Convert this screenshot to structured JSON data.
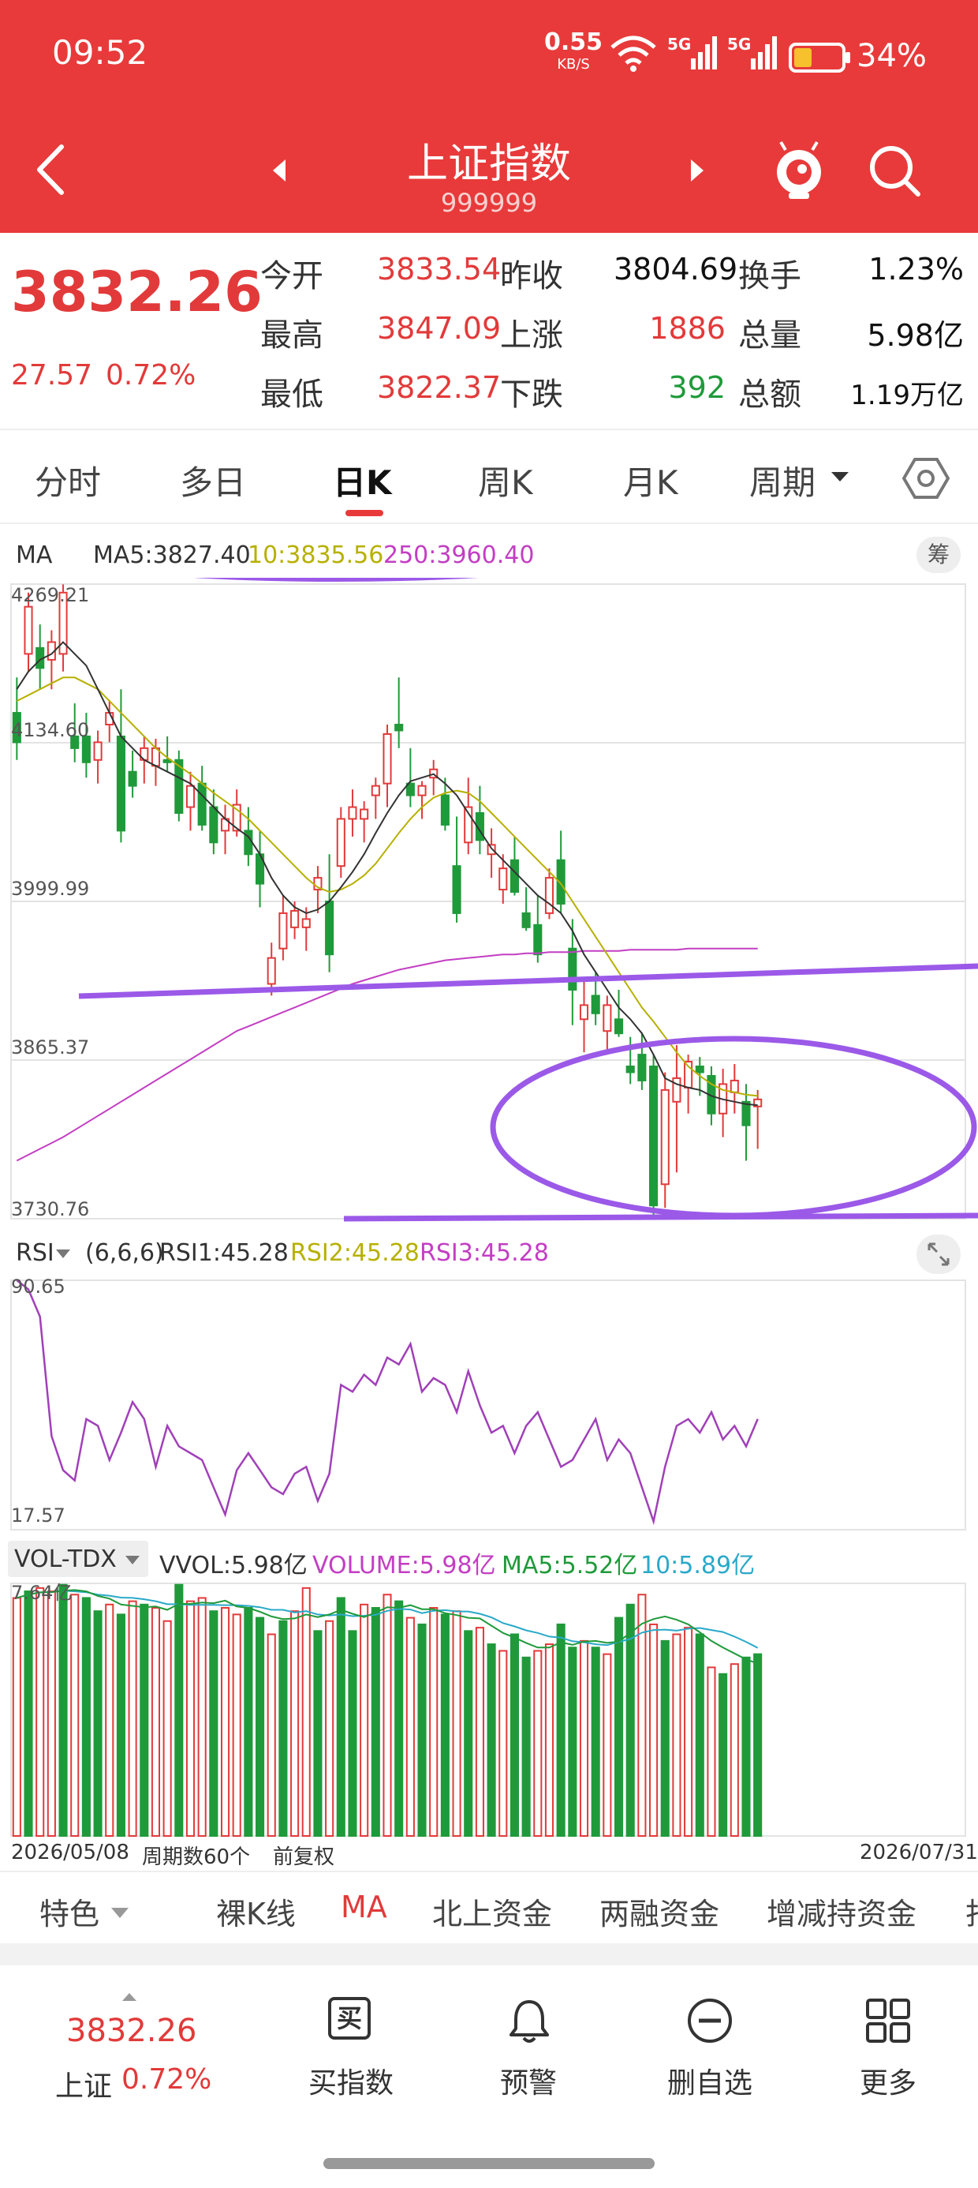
{
  "status_bar": {
    "time": "09:52",
    "net_speed": "0.55",
    "net_unit": "KB/S",
    "sig1": "5G",
    "sig2": "5G",
    "battery": "34%"
  },
  "header": {
    "title": "上证指数",
    "code": "999999"
  },
  "quote": {
    "price": "3832.26",
    "change": "27.57",
    "change_pct": "0.72%",
    "open_label": "今开",
    "open": "3833.54",
    "high_label": "最高",
    "high": "3847.09",
    "low_label": "最低",
    "low": "3822.37",
    "prev_label": "昨收",
    "prev": "3804.69",
    "up_label": "上涨",
    "up": "1886",
    "down_label": "下跌",
    "down": "392",
    "turnover_label": "换手",
    "turnover": "1.23%",
    "volume_label": "总量",
    "volume": "5.98亿",
    "amount_label": "总额",
    "amount": "1.19万亿"
  },
  "tabs": [
    "分时",
    "多日",
    "日K",
    "周K",
    "月K",
    "周期"
  ],
  "active_tab": 2,
  "ma_bar": {
    "name": "MA",
    "ma5": "MA5:3827.40",
    "ma10": "10:3835.56",
    "ma250": "250:3960.40",
    "chip_btn": "筹"
  },
  "price_axis": [
    "4269.21",
    "4134.60",
    "3999.99",
    "3865.37",
    "3730.76"
  ],
  "rsi_bar": {
    "name": "RSI",
    "params": "(6,6,6)",
    "rsi1": "RSI1:45.28",
    "rsi2": "RSI2:45.28",
    "rsi3": "RSI3:45.28"
  },
  "rsi_axis": [
    "90.65",
    "17.57"
  ],
  "vol_bar": {
    "name": "VOL-TDX",
    "vvol": "VVOL:5.98亿",
    "volume": "VOLUME:5.98亿",
    "ma5": "MA5:5.52亿",
    "ma10": "10:5.89亿"
  },
  "vol_axis": [
    "7.64亿"
  ],
  "footer_axis": {
    "start": "2026/05/08",
    "periods": "周期数60个",
    "adjust": "前复权",
    "end": "2026/07/31"
  },
  "indicator_tabs": [
    "特色",
    "裸K线",
    "MA",
    "北上资金",
    "两融资金",
    "增减持资金",
    "打"
  ],
  "bottom_nav": {
    "price": "3832.26",
    "name": "上证",
    "pct": "0.72%",
    "buy_icon_text": "买",
    "buy": "买指数",
    "alert": "预警",
    "remove": "删自选",
    "more": "更多"
  },
  "colors": {
    "up": "#e23a3a",
    "down": "#1f9a3a",
    "header": "#e83a3a",
    "annotation": "#9b59e8",
    "ma10": "#b7b000",
    "ma250": "#c33ec3"
  },
  "chart_data": {
    "type": "candlestick",
    "x_range": [
      "2026/05/08",
      "2026/07/31"
    ],
    "ylim": [
      3730.76,
      4269.21
    ],
    "candles_ohlc": [
      [
        4160,
        4190,
        4120,
        4135
      ],
      [
        4210,
        4262,
        4195,
        4250
      ],
      [
        4215,
        4235,
        4180,
        4198
      ],
      [
        4205,
        4230,
        4180,
        4220
      ],
      [
        4210,
        4269,
        4195,
        4262
      ],
      [
        4140,
        4168,
        4118,
        4130
      ],
      [
        4140,
        4160,
        4105,
        4118
      ],
      [
        4120,
        4145,
        4100,
        4135
      ],
      [
        4150,
        4170,
        4135,
        4160
      ],
      [
        4140,
        4180,
        4050,
        4060
      ],
      [
        4110,
        4128,
        4088,
        4098
      ],
      [
        4120,
        4140,
        4100,
        4130
      ],
      [
        4115,
        4138,
        4098,
        4130
      ],
      [
        4120,
        4140,
        4110,
        4118
      ],
      [
        4120,
        4128,
        4068,
        4075
      ],
      [
        4080,
        4110,
        4060,
        4098
      ],
      [
        4100,
        4115,
        4060,
        4065
      ],
      [
        4080,
        4095,
        4040,
        4050
      ],
      [
        4060,
        4082,
        4040,
        4070
      ],
      [
        4060,
        4095,
        4055,
        4082
      ],
      [
        4060,
        4080,
        4030,
        4040
      ],
      [
        4040,
        4060,
        3995,
        4015
      ],
      [
        3930,
        3965,
        3920,
        3952
      ],
      [
        3960,
        4005,
        3950,
        3990
      ],
      [
        3978,
        4000,
        3968,
        3992
      ],
      [
        3978,
        3995,
        3958,
        3985
      ],
      [
        4010,
        4030,
        3990,
        4020
      ],
      [
        4000,
        4040,
        3940,
        3955
      ],
      [
        4030,
        4080,
        4020,
        4070
      ],
      [
        4070,
        4095,
        4055,
        4080
      ],
      [
        4070,
        4085,
        4050,
        4078
      ],
      [
        4090,
        4105,
        4070,
        4098
      ],
      [
        4100,
        4150,
        4080,
        4142
      ],
      [
        4150,
        4190,
        4130,
        4145
      ],
      [
        4100,
        4130,
        4080,
        4090
      ],
      [
        4090,
        4102,
        4070,
        4098
      ],
      [
        4105,
        4120,
        4090,
        4112
      ],
      [
        4090,
        4105,
        4060,
        4065
      ],
      [
        4030,
        4072,
        3982,
        3990
      ],
      [
        4050,
        4105,
        4040,
        4080
      ],
      [
        4075,
        4098,
        4040,
        4052
      ],
      [
        4040,
        4062,
        4020,
        4048
      ],
      [
        4010,
        4040,
        3998,
        4028
      ],
      [
        4035,
        4055,
        4005,
        4008
      ],
      [
        3990,
        4012,
        3975,
        3978
      ],
      [
        3980,
        4005,
        3948,
        3955
      ],
      [
        3990,
        4028,
        3985,
        4020
      ],
      [
        4035,
        4060,
        3990,
        3998
      ],
      [
        3960,
        3985,
        3895,
        3925
      ],
      [
        3900,
        3935,
        3872,
        3912
      ],
      [
        3920,
        3940,
        3895,
        3905
      ],
      [
        3890,
        3920,
        3870,
        3912
      ],
      [
        3900,
        3925,
        3885,
        3888
      ],
      [
        3860,
        3885,
        3845,
        3855
      ],
      [
        3870,
        3888,
        3840,
        3848
      ],
      [
        3860,
        3870,
        3730,
        3742
      ],
      [
        3760,
        3855,
        3740,
        3840
      ],
      [
        3830,
        3878,
        3770,
        3850
      ],
      [
        3842,
        3870,
        3820,
        3864
      ],
      [
        3860,
        3868,
        3835,
        3855
      ],
      [
        3852,
        3860,
        3810,
        3820
      ],
      [
        3820,
        3858,
        3800,
        3845
      ],
      [
        3838,
        3862,
        3820,
        3848
      ],
      [
        3830,
        3845,
        3780,
        3810
      ],
      [
        3826,
        3840,
        3790,
        3832
      ]
    ],
    "ma5": [
      4180,
      4195,
      4205,
      4210,
      4220,
      4210,
      4200,
      4180,
      4160,
      4140,
      4130,
      4120,
      4115,
      4110,
      4105,
      4100,
      4090,
      4080,
      4070,
      4062,
      4055,
      4040,
      4020,
      4005,
      3995,
      3990,
      3993,
      4000,
      4012,
      4025,
      4040,
      4058,
      4075,
      4090,
      4102,
      4105,
      4108,
      4100,
      4090,
      4075,
      4060,
      4045,
      4035,
      4025,
      4015,
      4005,
      3998,
      3990,
      3975,
      3955,
      3940,
      3925,
      3910,
      3900,
      3888,
      3870,
      3850,
      3845,
      3842,
      3840,
      3835,
      3832,
      3830,
      3828,
      3827
    ],
    "ma10": [
      4170,
      4175,
      4180,
      4185,
      4190,
      4190,
      4185,
      4180,
      4170,
      4160,
      4150,
      4140,
      4130,
      4122,
      4115,
      4108,
      4100,
      4092,
      4085,
      4078,
      4070,
      4060,
      4050,
      4040,
      4030,
      4020,
      4012,
      4008,
      4010,
      4015,
      4022,
      4032,
      4045,
      4058,
      4070,
      4080,
      4088,
      4092,
      4094,
      4092,
      4085,
      4075,
      4065,
      4055,
      4045,
      4035,
      4025,
      4015,
      4000,
      3985,
      3970,
      3955,
      3940,
      3925,
      3910,
      3898,
      3885,
      3872,
      3860,
      3852,
      3845,
      3840,
      3838,
      3836,
      3835
    ],
    "ma250": [
      3780,
      3785,
      3790,
      3795,
      3800,
      3806,
      3812,
      3818,
      3824,
      3830,
      3836,
      3842,
      3848,
      3854,
      3860,
      3866,
      3872,
      3878,
      3884,
      3890,
      3894,
      3898,
      3902,
      3906,
      3910,
      3914,
      3918,
      3922,
      3926,
      3930,
      3933,
      3936,
      3939,
      3942,
      3944,
      3946,
      3948,
      3950,
      3951,
      3952,
      3953,
      3954,
      3955,
      3955,
      3956,
      3956,
      3957,
      3957,
      3957,
      3958,
      3958,
      3958,
      3958,
      3959,
      3959,
      3959,
      3959,
      3959,
      3960,
      3960,
      3960,
      3960,
      3960,
      3960,
      3960
    ],
    "rsi": [
      90.65,
      88,
      80,
      45,
      35,
      32,
      50,
      48,
      38,
      46,
      55,
      50,
      36,
      48,
      42,
      40,
      38,
      30,
      22,
      35,
      40,
      35,
      30,
      28,
      34,
      36,
      26,
      34,
      60,
      58,
      63,
      60,
      68,
      66,
      72,
      58,
      62,
      60,
      52,
      64,
      54,
      46,
      48,
      40,
      48,
      52,
      44,
      36,
      38,
      44,
      50,
      38,
      44,
      40,
      30,
      20,
      36,
      48,
      50,
      46,
      52,
      44,
      48,
      42,
      50
    ],
    "volume_yi": [
      7.2,
      7.4,
      7.5,
      7.4,
      7.6,
      7.3,
      7.2,
      6.8,
      7.0,
      6.7,
      7.1,
      7.0,
      6.9,
      6.5,
      7.6,
      7.1,
      7.2,
      6.8,
      6.9,
      6.7,
      6.9,
      6.6,
      6.1,
      6.5,
      6.8,
      7.5,
      6.2,
      6.5,
      7.2,
      6.2,
      7.0,
      6.9,
      7.3,
      7.1,
      6.6,
      6.4,
      6.9,
      6.7,
      6.8,
      6.2,
      6.3,
      5.8,
      5.6,
      6.1,
      5.4,
      5.6,
      5.8,
      6.4,
      5.7,
      5.9,
      5.7,
      5.5,
      6.6,
      7.0,
      7.3,
      6.4,
      5.9,
      6.1,
      6.3,
      6.1,
      5.1,
      4.9,
      5.2,
      5.4,
      5.5
    ],
    "volume_up": [
      true,
      false,
      true,
      true,
      false,
      true,
      false,
      false,
      true,
      false,
      true,
      false,
      true,
      true,
      false,
      true,
      true,
      false,
      true,
      true,
      false,
      false,
      true,
      false,
      true,
      true,
      false,
      true,
      false,
      false,
      true,
      false,
      true,
      false,
      true,
      false,
      true,
      false,
      true,
      false,
      true,
      false,
      true,
      false,
      false,
      true,
      true,
      false,
      false,
      true,
      false,
      true,
      false,
      false,
      true,
      true,
      false,
      true,
      true,
      false,
      true,
      false,
      true,
      false,
      false
    ]
  }
}
